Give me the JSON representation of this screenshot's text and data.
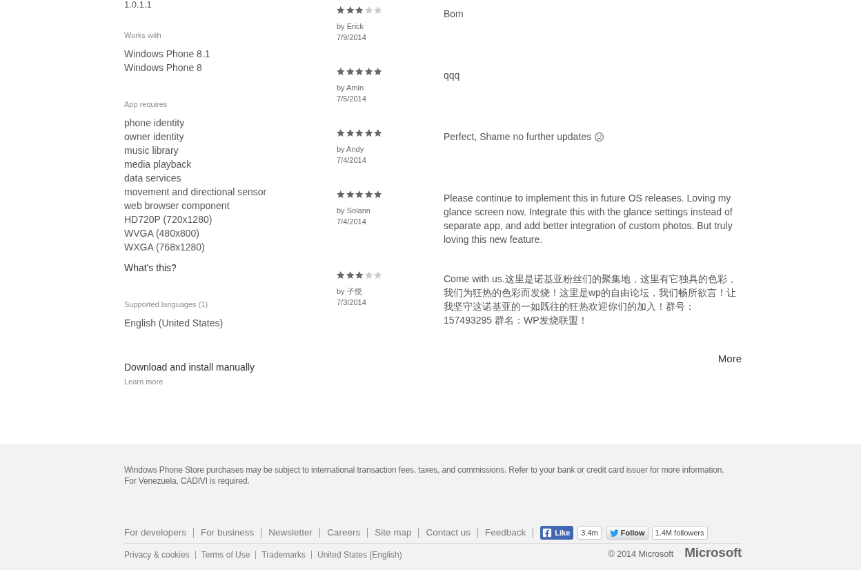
{
  "app_details": {
    "version": "1.0.1.1",
    "works_with": {
      "label": "Works with",
      "items": [
        "Windows Phone 8.1",
        "Windows Phone 8"
      ]
    },
    "app_requires": {
      "label": "App requires",
      "items": [
        "phone identity",
        "owner identity",
        "music library",
        "media playback",
        "data services",
        "movement and directional sensor",
        "web browser component",
        "HD720P (720x1280)",
        "WVGA (480x800)",
        "WXGA (768x1280)"
      ],
      "help_link": "What's this?"
    },
    "supported_languages": {
      "label": "Supported languages (1)",
      "items": [
        "English (United States)"
      ]
    },
    "manual_download": {
      "title": "Download and install manually",
      "link": "Learn more"
    }
  },
  "reviews": [
    {
      "stars": 3,
      "author": "by Erick",
      "date": "7/9/2014",
      "text": "Bom",
      "trailing_emoji": false
    },
    {
      "stars": 5,
      "author": "by Amin",
      "date": "7/5/2014",
      "text": "qqq",
      "trailing_emoji": false
    },
    {
      "stars": 5,
      "author": "by Andy",
      "date": "7/4/2014",
      "text": "Perfect, Shame no further updates",
      "trailing_emoji": true
    },
    {
      "stars": 5,
      "author": "by Solann",
      "date": "7/4/2014",
      "text": "Please continue to implement this in future OS releases. Loving my glance screen now. Integrate this with the glance settings instead of separate app, and add better integration of custom photos. But truly loving this new feature.",
      "trailing_emoji": false
    },
    {
      "stars": 3,
      "author": "by 子悦",
      "date": "7/3/2014",
      "text": "Come with us.这里是诺基亚粉丝们的聚集地，这里有它独具的色彩，我们为狂热的色彩而发烧！这里是wp的自由论坛，我们畅所欲言！让我坚守这诺基亚的一如既往的狂热欢迎你们的加入！群号：157493295 群名：WP发烧联盟！",
      "trailing_emoji": false
    }
  ],
  "more_link": "More",
  "footer": {
    "disclaimer": [
      "Windows Phone Store purchases may be subject to international transaction fees, taxes, and commissions. Refer to your bank or credit card issuer for more information.",
      "For Venezuela, CADIVI is required."
    ],
    "links": [
      "For developers",
      "For business",
      "Newsletter",
      "Careers",
      "Site map",
      "Contact us",
      "Feedback"
    ],
    "social": {
      "like": {
        "label": "Like",
        "count": "3.4m"
      },
      "follow": {
        "label": "Follow",
        "count": "1.4M followers"
      }
    },
    "legal_links": [
      "Privacy & cookies",
      "Terms of Use",
      "Trademarks",
      "United States (English)"
    ],
    "copyright": "© 2014 Microsoft",
    "logo": "Microsoft"
  }
}
